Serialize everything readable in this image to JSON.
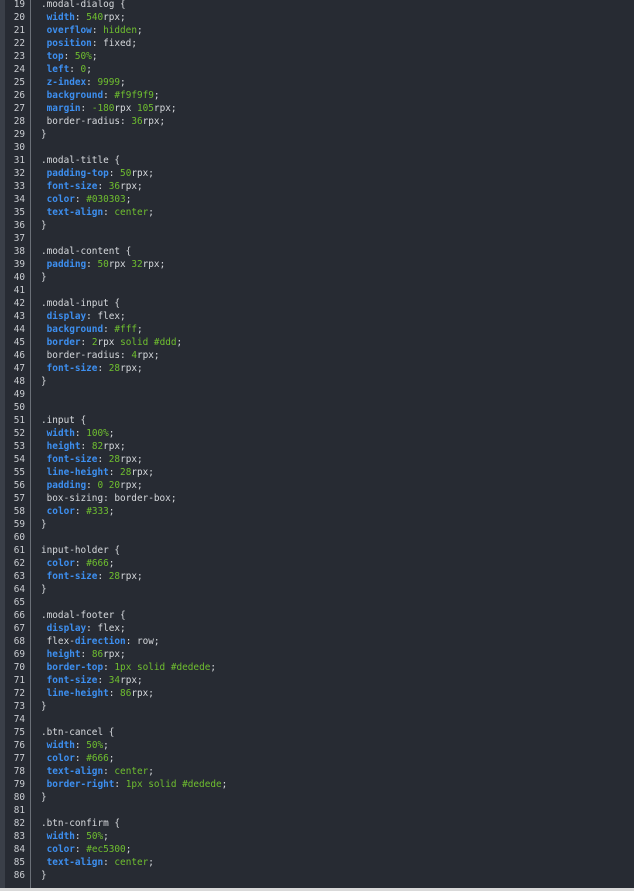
{
  "editor": {
    "lines": [
      {
        "n": "19",
        "parts": [
          {
            "t": ".modal-dialog {",
            "c": "d"
          }
        ]
      },
      {
        "n": "20",
        "parts": [
          {
            "t": " ",
            "c": "d"
          },
          {
            "t": "width",
            "c": "p"
          },
          {
            "t": ": ",
            "c": "d"
          },
          {
            "t": "540",
            "c": "n"
          },
          {
            "t": "rpx;",
            "c": "d"
          }
        ]
      },
      {
        "n": "21",
        "parts": [
          {
            "t": " ",
            "c": "d"
          },
          {
            "t": "overflow",
            "c": "p"
          },
          {
            "t": ": ",
            "c": "d"
          },
          {
            "t": "hidden",
            "c": "n"
          },
          {
            "t": ";",
            "c": "d"
          }
        ]
      },
      {
        "n": "22",
        "parts": [
          {
            "t": " ",
            "c": "d"
          },
          {
            "t": "position",
            "c": "p"
          },
          {
            "t": ": fixed;",
            "c": "d"
          }
        ]
      },
      {
        "n": "23",
        "parts": [
          {
            "t": " ",
            "c": "d"
          },
          {
            "t": "top",
            "c": "p"
          },
          {
            "t": ": ",
            "c": "d"
          },
          {
            "t": "50%",
            "c": "n"
          },
          {
            "t": ";",
            "c": "d"
          }
        ]
      },
      {
        "n": "24",
        "parts": [
          {
            "t": " ",
            "c": "d"
          },
          {
            "t": "left",
            "c": "p"
          },
          {
            "t": ": ",
            "c": "d"
          },
          {
            "t": "0",
            "c": "n"
          },
          {
            "t": ";",
            "c": "d"
          }
        ]
      },
      {
        "n": "25",
        "parts": [
          {
            "t": " ",
            "c": "d"
          },
          {
            "t": "z-index",
            "c": "p"
          },
          {
            "t": ": ",
            "c": "d"
          },
          {
            "t": "9999",
            "c": "n"
          },
          {
            "t": ";",
            "c": "d"
          }
        ]
      },
      {
        "n": "26",
        "parts": [
          {
            "t": " ",
            "c": "d"
          },
          {
            "t": "background",
            "c": "p"
          },
          {
            "t": ": ",
            "c": "d"
          },
          {
            "t": "#f9f9f9",
            "c": "n"
          },
          {
            "t": ";",
            "c": "d"
          }
        ]
      },
      {
        "n": "27",
        "parts": [
          {
            "t": " ",
            "c": "d"
          },
          {
            "t": "margin",
            "c": "p"
          },
          {
            "t": ": ",
            "c": "d"
          },
          {
            "t": "-180",
            "c": "n"
          },
          {
            "t": "rpx ",
            "c": "d"
          },
          {
            "t": "105",
            "c": "n"
          },
          {
            "t": "rpx;",
            "c": "d"
          }
        ]
      },
      {
        "n": "28",
        "parts": [
          {
            "t": " border-radius: ",
            "c": "d"
          },
          {
            "t": "36",
            "c": "n"
          },
          {
            "t": "rpx;",
            "c": "d"
          }
        ]
      },
      {
        "n": "29",
        "parts": [
          {
            "t": "}",
            "c": "d"
          }
        ]
      },
      {
        "n": "30",
        "parts": []
      },
      {
        "n": "31",
        "parts": [
          {
            "t": ".modal-title {",
            "c": "d"
          }
        ]
      },
      {
        "n": "32",
        "parts": [
          {
            "t": " ",
            "c": "d"
          },
          {
            "t": "padding-top",
            "c": "p"
          },
          {
            "t": ": ",
            "c": "d"
          },
          {
            "t": "50",
            "c": "n"
          },
          {
            "t": "rpx;",
            "c": "d"
          }
        ]
      },
      {
        "n": "33",
        "parts": [
          {
            "t": " ",
            "c": "d"
          },
          {
            "t": "font-size",
            "c": "p"
          },
          {
            "t": ": ",
            "c": "d"
          },
          {
            "t": "36",
            "c": "n"
          },
          {
            "t": "rpx;",
            "c": "d"
          }
        ]
      },
      {
        "n": "34",
        "parts": [
          {
            "t": " ",
            "c": "d"
          },
          {
            "t": "color",
            "c": "p"
          },
          {
            "t": ": ",
            "c": "d"
          },
          {
            "t": "#030303",
            "c": "n"
          },
          {
            "t": ";",
            "c": "d"
          }
        ]
      },
      {
        "n": "35",
        "parts": [
          {
            "t": " ",
            "c": "d"
          },
          {
            "t": "text-align",
            "c": "p"
          },
          {
            "t": ": ",
            "c": "d"
          },
          {
            "t": "center",
            "c": "n"
          },
          {
            "t": ";",
            "c": "d"
          }
        ]
      },
      {
        "n": "36",
        "parts": [
          {
            "t": "}",
            "c": "d"
          }
        ]
      },
      {
        "n": "37",
        "parts": []
      },
      {
        "n": "38",
        "parts": [
          {
            "t": ".modal-content {",
            "c": "d"
          }
        ]
      },
      {
        "n": "39",
        "parts": [
          {
            "t": " ",
            "c": "d"
          },
          {
            "t": "padding",
            "c": "p"
          },
          {
            "t": ": ",
            "c": "d"
          },
          {
            "t": "50",
            "c": "n"
          },
          {
            "t": "rpx ",
            "c": "d"
          },
          {
            "t": "32",
            "c": "n"
          },
          {
            "t": "rpx;",
            "c": "d"
          }
        ]
      },
      {
        "n": "40",
        "parts": [
          {
            "t": "}",
            "c": "d"
          }
        ]
      },
      {
        "n": "41",
        "parts": []
      },
      {
        "n": "42",
        "parts": [
          {
            "t": ".modal-input {",
            "c": "d"
          }
        ]
      },
      {
        "n": "43",
        "parts": [
          {
            "t": " ",
            "c": "d"
          },
          {
            "t": "display",
            "c": "p"
          },
          {
            "t": ": flex;",
            "c": "d"
          }
        ]
      },
      {
        "n": "44",
        "parts": [
          {
            "t": " ",
            "c": "d"
          },
          {
            "t": "background",
            "c": "p"
          },
          {
            "t": ": ",
            "c": "d"
          },
          {
            "t": "#fff",
            "c": "n"
          },
          {
            "t": ";",
            "c": "d"
          }
        ]
      },
      {
        "n": "45",
        "parts": [
          {
            "t": " ",
            "c": "d"
          },
          {
            "t": "border",
            "c": "p"
          },
          {
            "t": ": ",
            "c": "d"
          },
          {
            "t": "2",
            "c": "n"
          },
          {
            "t": "rpx ",
            "c": "d"
          },
          {
            "t": "solid #ddd",
            "c": "n"
          },
          {
            "t": ";",
            "c": "d"
          }
        ]
      },
      {
        "n": "46",
        "parts": [
          {
            "t": " border-radius: ",
            "c": "d"
          },
          {
            "t": "4",
            "c": "n"
          },
          {
            "t": "rpx;",
            "c": "d"
          }
        ]
      },
      {
        "n": "47",
        "parts": [
          {
            "t": " ",
            "c": "d"
          },
          {
            "t": "font-size",
            "c": "p"
          },
          {
            "t": ": ",
            "c": "d"
          },
          {
            "t": "28",
            "c": "n"
          },
          {
            "t": "rpx;",
            "c": "d"
          }
        ]
      },
      {
        "n": "48",
        "parts": [
          {
            "t": "}",
            "c": "d"
          }
        ]
      },
      {
        "n": "49",
        "parts": []
      },
      {
        "n": "50",
        "parts": []
      },
      {
        "n": "51",
        "parts": [
          {
            "t": ".input {",
            "c": "d"
          }
        ]
      },
      {
        "n": "52",
        "parts": [
          {
            "t": " ",
            "c": "d"
          },
          {
            "t": "width",
            "c": "p"
          },
          {
            "t": ": ",
            "c": "d"
          },
          {
            "t": "100%",
            "c": "n"
          },
          {
            "t": ";",
            "c": "d"
          }
        ]
      },
      {
        "n": "53",
        "parts": [
          {
            "t": " ",
            "c": "d"
          },
          {
            "t": "height",
            "c": "p"
          },
          {
            "t": ": ",
            "c": "d"
          },
          {
            "t": "82",
            "c": "n"
          },
          {
            "t": "rpx;",
            "c": "d"
          }
        ]
      },
      {
        "n": "54",
        "parts": [
          {
            "t": " ",
            "c": "d"
          },
          {
            "t": "font-size",
            "c": "p"
          },
          {
            "t": ": ",
            "c": "d"
          },
          {
            "t": "28",
            "c": "n"
          },
          {
            "t": "rpx;",
            "c": "d"
          }
        ]
      },
      {
        "n": "55",
        "parts": [
          {
            "t": " ",
            "c": "d"
          },
          {
            "t": "line-height",
            "c": "p"
          },
          {
            "t": ": ",
            "c": "d"
          },
          {
            "t": "28",
            "c": "n"
          },
          {
            "t": "rpx;",
            "c": "d"
          }
        ]
      },
      {
        "n": "56",
        "parts": [
          {
            "t": " ",
            "c": "d"
          },
          {
            "t": "padding",
            "c": "p"
          },
          {
            "t": ": ",
            "c": "d"
          },
          {
            "t": "0 20",
            "c": "n"
          },
          {
            "t": "rpx;",
            "c": "d"
          }
        ]
      },
      {
        "n": "57",
        "parts": [
          {
            "t": " box-sizing: border-box;",
            "c": "d"
          }
        ]
      },
      {
        "n": "58",
        "parts": [
          {
            "t": " ",
            "c": "d"
          },
          {
            "t": "color",
            "c": "p"
          },
          {
            "t": ": ",
            "c": "d"
          },
          {
            "t": "#333",
            "c": "n"
          },
          {
            "t": ";",
            "c": "d"
          }
        ]
      },
      {
        "n": "59",
        "parts": [
          {
            "t": "}",
            "c": "d"
          }
        ]
      },
      {
        "n": "60",
        "parts": []
      },
      {
        "n": "61",
        "parts": [
          {
            "t": "input-holder {",
            "c": "d"
          }
        ]
      },
      {
        "n": "62",
        "parts": [
          {
            "t": " ",
            "c": "d"
          },
          {
            "t": "color",
            "c": "p"
          },
          {
            "t": ": ",
            "c": "d"
          },
          {
            "t": "#666",
            "c": "n"
          },
          {
            "t": ";",
            "c": "d"
          }
        ]
      },
      {
        "n": "63",
        "parts": [
          {
            "t": " ",
            "c": "d"
          },
          {
            "t": "font-size",
            "c": "p"
          },
          {
            "t": ": ",
            "c": "d"
          },
          {
            "t": "28",
            "c": "n"
          },
          {
            "t": "rpx;",
            "c": "d"
          }
        ]
      },
      {
        "n": "64",
        "parts": [
          {
            "t": "}",
            "c": "d"
          }
        ]
      },
      {
        "n": "65",
        "parts": []
      },
      {
        "n": "66",
        "parts": [
          {
            "t": ".modal-footer {",
            "c": "d"
          }
        ]
      },
      {
        "n": "67",
        "parts": [
          {
            "t": " ",
            "c": "d"
          },
          {
            "t": "display",
            "c": "p"
          },
          {
            "t": ": flex;",
            "c": "d"
          }
        ]
      },
      {
        "n": "68",
        "parts": [
          {
            "t": " flex-",
            "c": "d"
          },
          {
            "t": "direction",
            "c": "p"
          },
          {
            "t": ": row;",
            "c": "d"
          }
        ]
      },
      {
        "n": "69",
        "parts": [
          {
            "t": " ",
            "c": "d"
          },
          {
            "t": "height",
            "c": "p"
          },
          {
            "t": ": ",
            "c": "d"
          },
          {
            "t": "86",
            "c": "n"
          },
          {
            "t": "rpx;",
            "c": "d"
          }
        ]
      },
      {
        "n": "70",
        "parts": [
          {
            "t": " ",
            "c": "d"
          },
          {
            "t": "border-top",
            "c": "p"
          },
          {
            "t": ": ",
            "c": "d"
          },
          {
            "t": "1px solid #dedede",
            "c": "n"
          },
          {
            "t": ";",
            "c": "d"
          }
        ]
      },
      {
        "n": "71",
        "parts": [
          {
            "t": " ",
            "c": "d"
          },
          {
            "t": "font-size",
            "c": "p"
          },
          {
            "t": ": ",
            "c": "d"
          },
          {
            "t": "34",
            "c": "n"
          },
          {
            "t": "rpx;",
            "c": "d"
          }
        ]
      },
      {
        "n": "72",
        "parts": [
          {
            "t": " ",
            "c": "d"
          },
          {
            "t": "line-height",
            "c": "p"
          },
          {
            "t": ": ",
            "c": "d"
          },
          {
            "t": "86",
            "c": "n"
          },
          {
            "t": "rpx;",
            "c": "d"
          }
        ]
      },
      {
        "n": "73",
        "parts": [
          {
            "t": "}",
            "c": "d"
          }
        ]
      },
      {
        "n": "74",
        "parts": []
      },
      {
        "n": "75",
        "parts": [
          {
            "t": ".btn-cancel {",
            "c": "d"
          }
        ]
      },
      {
        "n": "76",
        "parts": [
          {
            "t": " ",
            "c": "d"
          },
          {
            "t": "width",
            "c": "p"
          },
          {
            "t": ": ",
            "c": "d"
          },
          {
            "t": "50%",
            "c": "n"
          },
          {
            "t": ";",
            "c": "d"
          }
        ]
      },
      {
        "n": "77",
        "parts": [
          {
            "t": " ",
            "c": "d"
          },
          {
            "t": "color",
            "c": "p"
          },
          {
            "t": ": ",
            "c": "d"
          },
          {
            "t": "#666",
            "c": "n"
          },
          {
            "t": ";",
            "c": "d"
          }
        ]
      },
      {
        "n": "78",
        "parts": [
          {
            "t": " ",
            "c": "d"
          },
          {
            "t": "text-align",
            "c": "p"
          },
          {
            "t": ": ",
            "c": "d"
          },
          {
            "t": "center",
            "c": "n"
          },
          {
            "t": ";",
            "c": "d"
          }
        ]
      },
      {
        "n": "79",
        "parts": [
          {
            "t": " ",
            "c": "d"
          },
          {
            "t": "border-right",
            "c": "p"
          },
          {
            "t": ": ",
            "c": "d"
          },
          {
            "t": "1px solid #dedede",
            "c": "n"
          },
          {
            "t": ";",
            "c": "d"
          }
        ]
      },
      {
        "n": "80",
        "parts": [
          {
            "t": "}",
            "c": "d"
          }
        ]
      },
      {
        "n": "81",
        "parts": []
      },
      {
        "n": "82",
        "parts": [
          {
            "t": ".btn-confirm {",
            "c": "d"
          }
        ]
      },
      {
        "n": "83",
        "parts": [
          {
            "t": " ",
            "c": "d"
          },
          {
            "t": "width",
            "c": "p"
          },
          {
            "t": ": ",
            "c": "d"
          },
          {
            "t": "50%",
            "c": "n"
          },
          {
            "t": ";",
            "c": "d"
          }
        ]
      },
      {
        "n": "84",
        "parts": [
          {
            "t": " ",
            "c": "d"
          },
          {
            "t": "color",
            "c": "p"
          },
          {
            "t": ": ",
            "c": "d"
          },
          {
            "t": "#ec5300",
            "c": "n"
          },
          {
            "t": ";",
            "c": "d"
          }
        ]
      },
      {
        "n": "85",
        "parts": [
          {
            "t": " ",
            "c": "d"
          },
          {
            "t": "text-align",
            "c": "p"
          },
          {
            "t": ": ",
            "c": "d"
          },
          {
            "t": "center",
            "c": "n"
          },
          {
            "t": ";",
            "c": "d"
          }
        ]
      },
      {
        "n": "86",
        "parts": [
          {
            "t": "}",
            "c": "d"
          }
        ]
      }
    ]
  },
  "colors": {
    "background": "#272b33",
    "line_number": "#c9ccd1",
    "default_text": "#d6d9dd",
    "property_keyword": "#3d8ff0",
    "value_literal": "#6fbf2f"
  }
}
